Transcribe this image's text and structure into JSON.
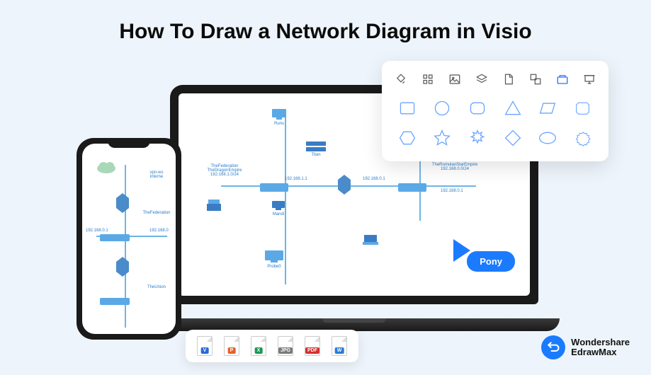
{
  "page": {
    "title": "How To Draw a Network Diagram in Visio"
  },
  "toolbar": {
    "icons": [
      "fill-icon",
      "grid-icon",
      "image-icon",
      "layers-icon",
      "page-icon",
      "arrange-icon",
      "shapes-icon",
      "presentation-icon"
    ],
    "active_index": 6
  },
  "shapes": {
    "row1": [
      "rectangle",
      "circle",
      "rounded-rect",
      "triangle",
      "parallelogram",
      "chamfered-rect"
    ],
    "row2": [
      "hexagon",
      "star",
      "burst",
      "diamond",
      "ellipse",
      "seal"
    ]
  },
  "badge": {
    "text": "Pony"
  },
  "file_formats": [
    {
      "label": "V",
      "color": "#2a6bd4"
    },
    {
      "label": "P",
      "color": "#e8602c"
    },
    {
      "label": "X",
      "color": "#1a9850"
    },
    {
      "label": "JPG",
      "color": "#7a7a7a"
    },
    {
      "label": "PDF",
      "color": "#d62e2e"
    },
    {
      "label": "W",
      "color": "#2a7cd4"
    }
  ],
  "brand": {
    "line1": "Wondershare",
    "line2": "EdrawMax"
  },
  "network_laptop": {
    "nodes": [
      {
        "key": "runs",
        "label": "Runs"
      },
      {
        "key": "titan",
        "label": "Titan"
      },
      {
        "key": "federation",
        "label": "TheFederation\nTheDragonEmpire\n192.168.1.0/24"
      },
      {
        "key": "ip1",
        "label": "192.168.1.1"
      },
      {
        "key": "ip2",
        "label": "192.168.0.1"
      },
      {
        "key": "mandi",
        "label": "Mandi"
      },
      {
        "key": "probe",
        "label": "Probe0"
      },
      {
        "key": "romulan",
        "label": "TheRomulanStarEmpire\n192.168.0.0/24"
      },
      {
        "key": "ip3",
        "label": "192.168.0.1"
      }
    ]
  },
  "network_phone": {
    "nodes": [
      {
        "key": "cloud",
        "label": ""
      },
      {
        "key": "vpn",
        "label": "vpn-ws\ninterne"
      },
      {
        "key": "federation",
        "label": "TheFederation"
      },
      {
        "key": "ip",
        "label": "192.168.0.1"
      },
      {
        "key": "ip2",
        "label": "192.168.0"
      },
      {
        "key": "union",
        "label": "TheUnion"
      }
    ]
  }
}
